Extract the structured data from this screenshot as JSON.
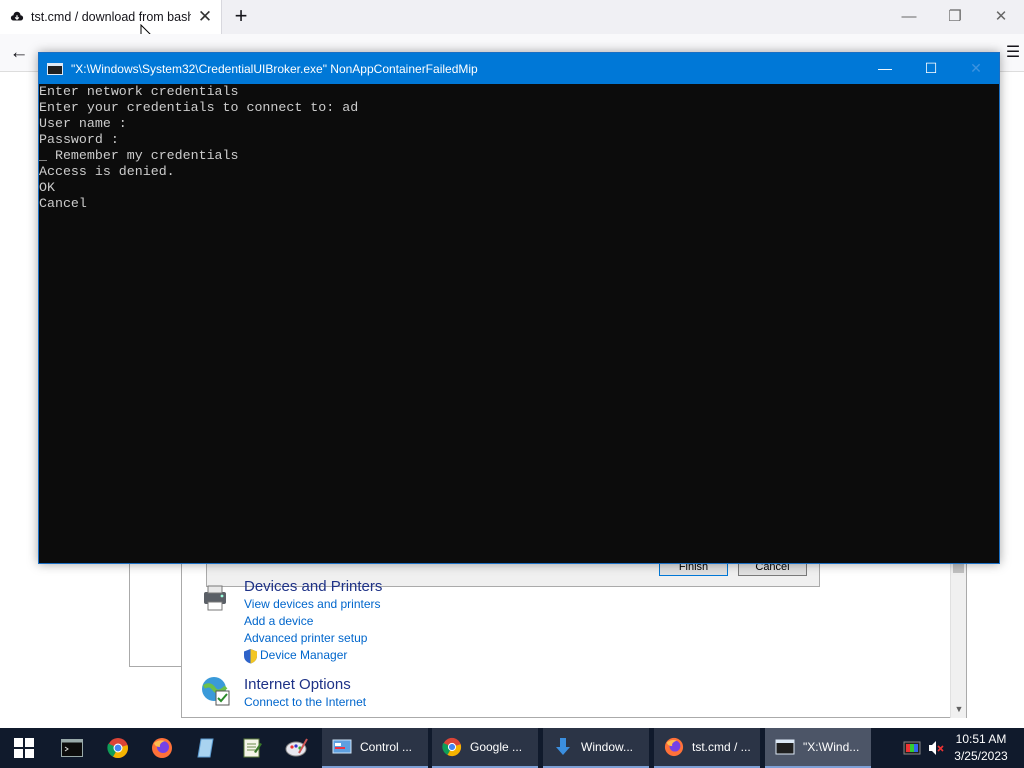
{
  "browser": {
    "tab_title": "tst.cmd / download from bash",
    "tab_close": "✕",
    "new_tab": "+",
    "minimize": "—",
    "restore": "❐",
    "close": "✕",
    "back": "←",
    "reload": "↻",
    "home": "⌂"
  },
  "console": {
    "title": "\"X:\\Windows\\System32\\CredentialUIBroker.exe\" NonAppContainerFailedMip",
    "minimize": "—",
    "maximize": "☐",
    "close": "✕",
    "lines": [
      "Enter network credentials",
      "Enter your credentials to connect to: ad",
      "User name :",
      "Password :",
      "_ Remember my credentials",
      "Access is denied.",
      "OK",
      "Cancel"
    ]
  },
  "wizard": {
    "finish": "Finish",
    "cancel": "Cancel"
  },
  "control_panel": {
    "devices_title": "Devices and Printers",
    "devices_links": [
      "View devices and printers",
      "Add a device",
      "Advanced printer setup"
    ],
    "device_manager": "Device Manager",
    "internet_title": "Internet Options",
    "internet_link": "Connect to the Internet"
  },
  "taskbar": {
    "tasks": [
      {
        "label": "Control ..."
      },
      {
        "label": "Google ..."
      },
      {
        "label": "Window..."
      },
      {
        "label": "tst.cmd / ..."
      },
      {
        "label": "\"X:\\Wind..."
      }
    ],
    "time": "10:51 AM",
    "date": "3/25/2023"
  },
  "colors": {
    "console_bg": "#0c0c0c",
    "console_text": "#cccccc",
    "titlebar": "#0078d7",
    "taskbar": "#101a2c",
    "link": "#0066cc",
    "section_title": "#1e3287"
  }
}
